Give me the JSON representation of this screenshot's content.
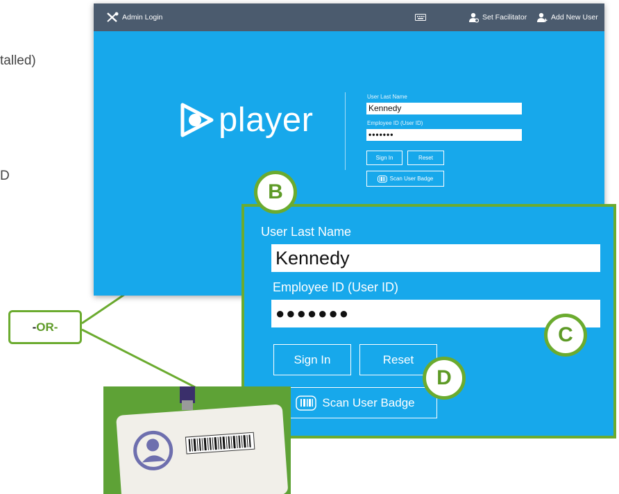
{
  "edge_texts": {
    "installed": "talled)",
    "id": "D"
  },
  "topbar": {
    "admin_login": "Admin Login",
    "keyboard_icon": "keyboard-icon",
    "set_facilitator": "Set Facilitator",
    "add_new_user": "Add New User"
  },
  "logo": {
    "word": "player"
  },
  "login_form": {
    "last_name_label": "User Last Name",
    "last_name_value": "Kennedy",
    "employee_id_label": "Employee ID (User ID)",
    "employee_id_value": "•••••••",
    "sign_in": "Sign In",
    "reset": "Reset",
    "scan_badge": "Scan User Badge"
  },
  "zoom_panel": {
    "last_name_label": "User Last Name",
    "last_name_value": "Kennedy",
    "employee_id_label": "Employee ID (User ID)",
    "employee_id_value": "●●●●●●●",
    "sign_in": "Sign In",
    "reset": "Reset",
    "scan_badge": "Scan User Badge"
  },
  "callouts": {
    "b": "B",
    "c": "C",
    "d": "D"
  },
  "or_box": {
    "prefix": "-",
    "text": "OR",
    "suffix": "-"
  },
  "colors": {
    "app_bg": "#17a8eb",
    "topbar_bg": "#4b5b6e",
    "accent_green": "#6bab2f"
  }
}
